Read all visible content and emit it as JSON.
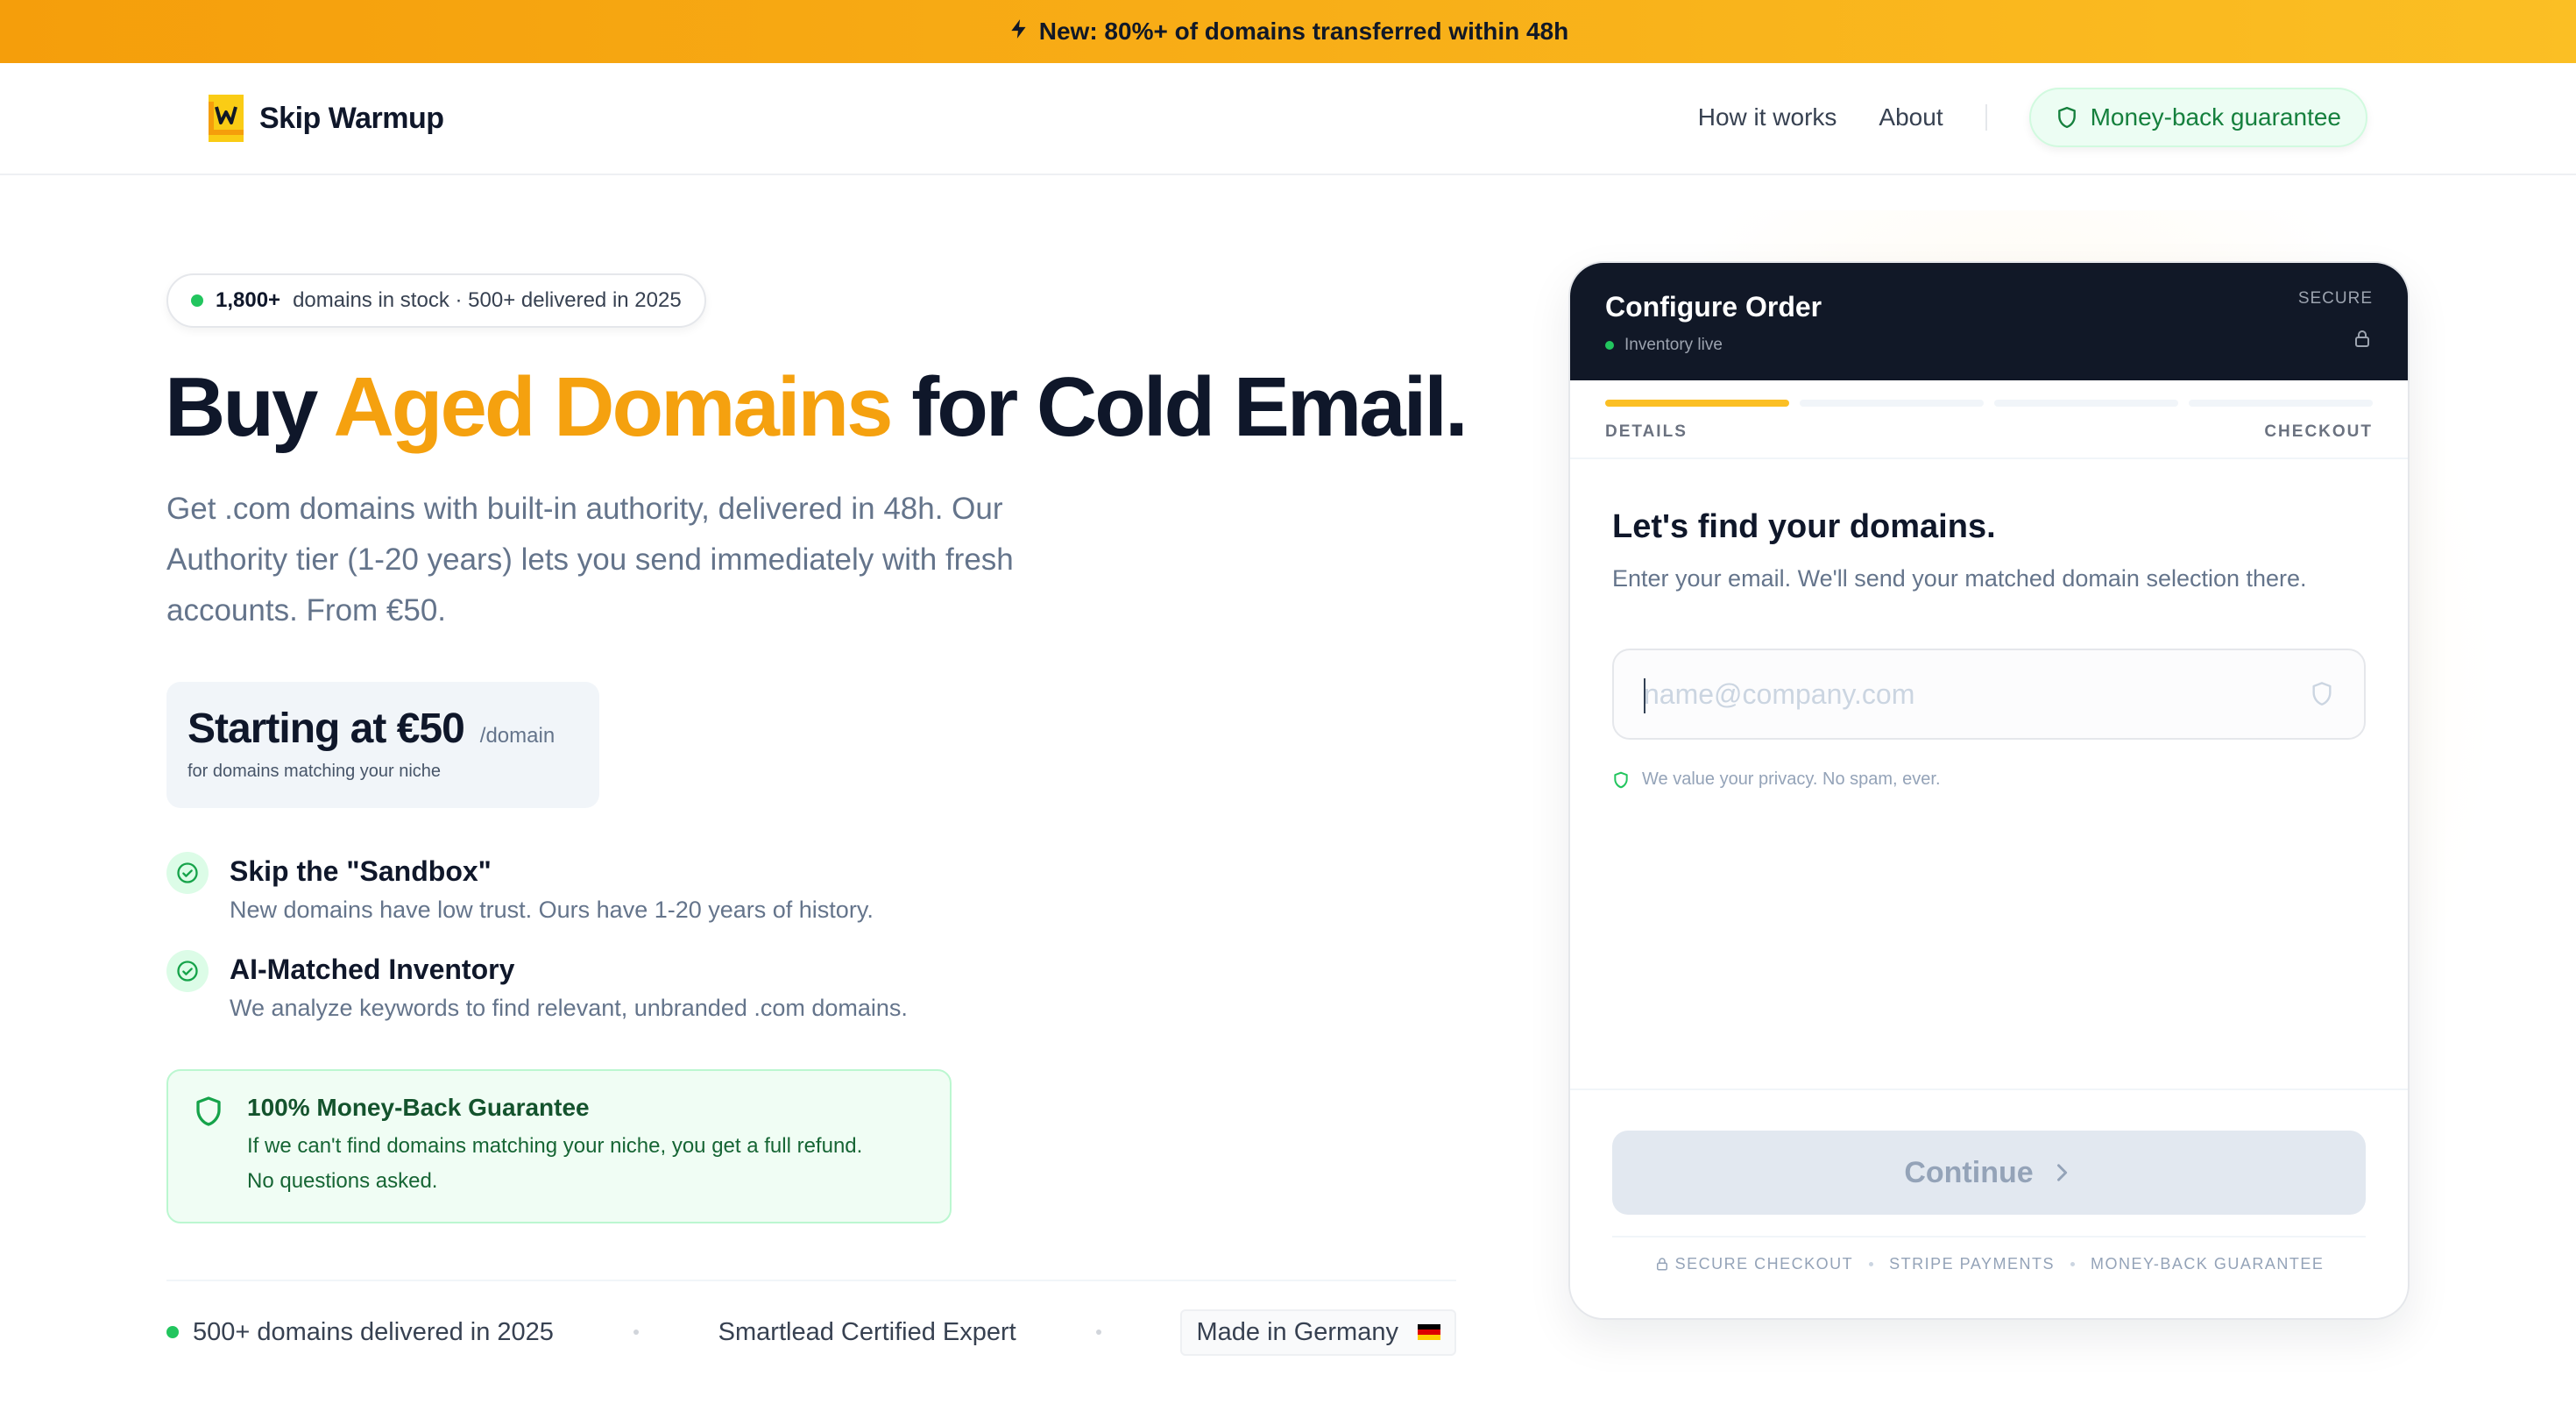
{
  "announcement": {
    "icon": "lightning-icon",
    "text": "New: 80%+ of domains transferred within 48h"
  },
  "nav": {
    "brand": "Skip Warmup",
    "links": [
      "How it works",
      "About"
    ],
    "guarantee_pill": "Money-back guarantee"
  },
  "hero": {
    "stock_count": "1,800+",
    "stock_text": "domains in stock · 500+ delivered in 2025",
    "headline_pre": "Buy",
    "headline_accent": "Aged Domains",
    "headline_post": "for Cold Email.",
    "subtext": "Get .com domains with built-in authority, delivered in 48h. Our Authority tier (1-20 years) lets you send immediately with fresh accounts. From €50.",
    "price_main": "Starting at €50",
    "price_unit": "/domain",
    "price_sub": "for domains matching your niche",
    "features": [
      {
        "title": "Skip the \"Sandbox\"",
        "desc": "New domains have low trust. Ours have 1-20 years of history."
      },
      {
        "title": "AI-Matched Inventory",
        "desc": "We analyze keywords to find relevant, unbranded .com domains."
      }
    ],
    "guarantee_title": "100% Money-Back Guarantee",
    "guarantee_desc_1": "If we can't find domains matching your niche, you get a full refund.",
    "guarantee_desc_2": "No questions asked.",
    "trust": [
      "500+ domains delivered in 2025",
      "Smartlead Certified Expert",
      "Made in Germany"
    ]
  },
  "order_card": {
    "title": "Configure Order",
    "status": "Inventory live",
    "secure_label": "SECURE",
    "steps": [
      "DETAILS",
      "CHECKOUT"
    ],
    "progress_fraction": 0.25,
    "heading": "Let's find your domains.",
    "description": "Enter your email. We'll send your matched domain selection there.",
    "email_placeholder": "name@company.com",
    "email_value": "",
    "privacy_note": "We value your privacy. No spam, ever.",
    "continue_label": "Continue",
    "footer_badges": [
      "SECURE CHECKOUT",
      "STRIPE PAYMENTS",
      "MONEY-BACK GUARANTEE"
    ]
  },
  "colors": {
    "accent": "#f5a10f",
    "dark": "#111827",
    "green": "#22c55e"
  }
}
